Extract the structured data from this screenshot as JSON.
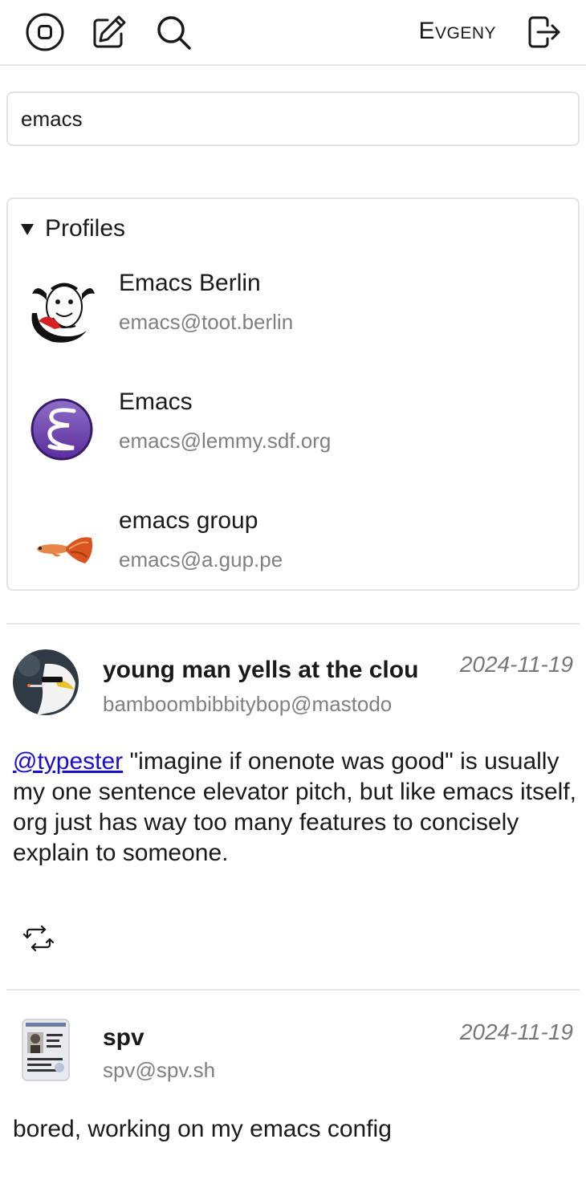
{
  "topbar": {
    "username": "Evgeny",
    "icons": [
      "stop-circle-icon",
      "compose-icon",
      "search-icon",
      "logout-icon"
    ]
  },
  "search": {
    "value": "emacs"
  },
  "profiles": {
    "title": "Profiles",
    "items": [
      {
        "name": "Emacs Berlin",
        "handle": "emacs@toot.berlin"
      },
      {
        "name": "Emacs",
        "handle": "emacs@lemmy.sdf.org"
      },
      {
        "name": "emacs group",
        "handle": "emacs@a.gup.pe"
      }
    ]
  },
  "posts": [
    {
      "author": "young man yells at the clou",
      "handle": "bamboombibbitybop@mastodo",
      "date": "2024-11-19",
      "mention": "@typester",
      "text": " \"imagine if onenote was good\" is usually my one sentence elevator pitch, but like emacs itself, org just has way too many features to concisely explain to someone."
    },
    {
      "author": "spv",
      "handle": "spv@spv.sh",
      "date": "2024-11-19",
      "text": "bored, working on my emacs config"
    }
  ],
  "colors": {
    "link": "#1a0dcc",
    "muted": "#808080",
    "border": "#e3e3e3",
    "emacs_purple": "#7f5ab6"
  }
}
